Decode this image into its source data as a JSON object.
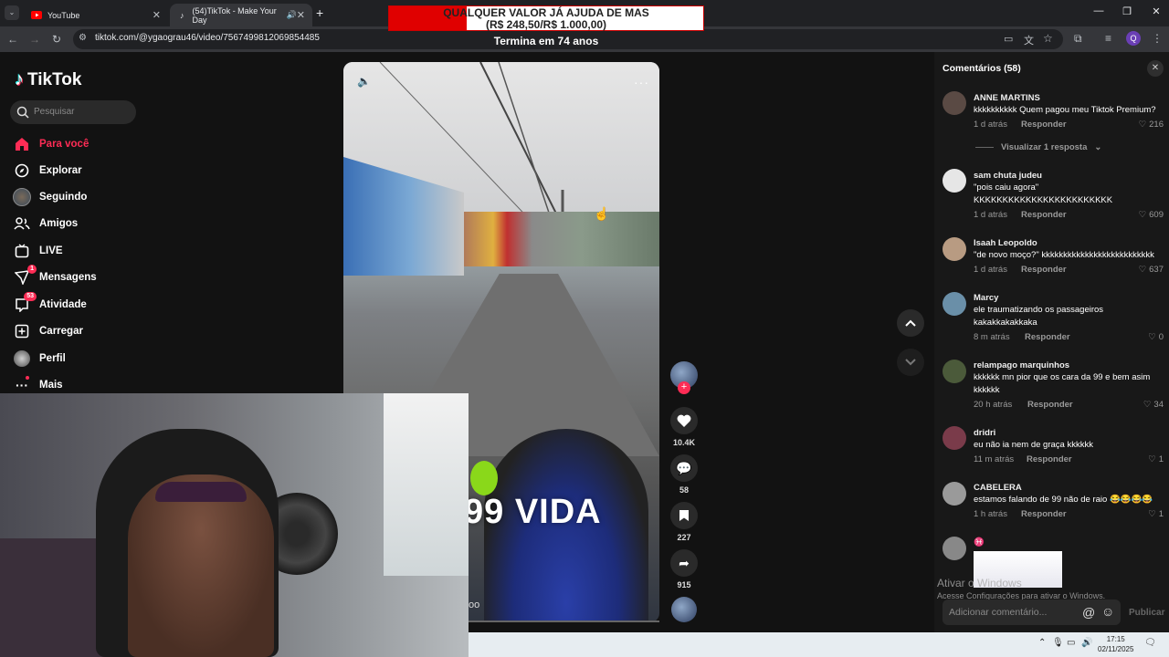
{
  "browser": {
    "tabs": [
      {
        "label": "YouTube",
        "active": false
      },
      {
        "label": "(54)TikTok - Make Your Day",
        "active": true
      }
    ],
    "url": "tiktok.com/@ygaograu46/video/7567499812069854485"
  },
  "donation": {
    "line1": "QUALQUER VALOR JÁ AJUDA DE MAS",
    "line2": "(R$ 248,50/R$ 1.000,00)",
    "line3": "Termina em 74 anos"
  },
  "sidebar": {
    "logo": "TikTok",
    "search_placeholder": "Pesquisar",
    "items": [
      {
        "label": "Para você",
        "icon": "home-icon",
        "active": true
      },
      {
        "label": "Explorar",
        "icon": "compass-icon"
      },
      {
        "label": "Seguindo",
        "icon": "avatar-icon"
      },
      {
        "label": "Amigos",
        "icon": "friends-icon"
      },
      {
        "label": "LIVE",
        "icon": "live-icon"
      },
      {
        "label": "Mensagens",
        "icon": "messages-icon",
        "badge": "1"
      },
      {
        "label": "Atividade",
        "icon": "activity-icon",
        "badge": "53"
      },
      {
        "label": "Carregar",
        "icon": "upload-icon"
      },
      {
        "label": "Perfil",
        "icon": "profile-icon"
      },
      {
        "label": "Mais",
        "icon": "more-icon"
      }
    ]
  },
  "video": {
    "caption_overlay": "99 VIDA",
    "likes": "10.4K",
    "comments": "58",
    "saves": "227",
    "shares": "915",
    "bottom_fragment": "oo"
  },
  "comments": {
    "title": "Comentários (58)",
    "view_replies": "Visualizar 1 resposta",
    "reply_label": "Responder",
    "items": [
      {
        "user": "ANNE MARTINS",
        "text": "kkkkkkkkkk Quem pagou meu Tiktok Premium?",
        "time": "1 d atrás",
        "likes": "216",
        "avatar": "#5a4a44"
      },
      {
        "user": "sam chuta judeu",
        "text": "\"pois caiu agora\" KKKKKKKKKKKKKKKKKKKKKKKK",
        "time": "1 d atrás",
        "likes": "609",
        "avatar": "#e6e6e6"
      },
      {
        "user": "Isaah Leopoldo",
        "text": "\"de novo moço?\" kkkkkkkkkkkkkkkkkkkkkkkkkk",
        "time": "1 d atrás",
        "likes": "637",
        "avatar": "#b89b82"
      },
      {
        "user": "Marcy",
        "text": "ele traumatizando os passageiros kakakkakakkaka",
        "time": "8 m atrás",
        "likes": "0",
        "avatar": "#6a8fa8"
      },
      {
        "user": "relampago marquinhos",
        "text": "kkkkkk mn pior que os cara da 99 e bem asim kkkkkk",
        "time": "20 h atrás",
        "likes": "34",
        "avatar": "#4b5a3a"
      },
      {
        "user": "dridri",
        "text": "eu não ia nem de graça kkkkkk",
        "time": "11 m atrás",
        "likes": "1",
        "avatar": "#7a3b4a"
      },
      {
        "user": "CABELERA",
        "text": "estamos falando de 99 não de raio 😂😂😂😂",
        "time": "1 h atrás",
        "likes": "1",
        "avatar": "#9a9a9a"
      },
      {
        "user": "♓",
        "text": "",
        "time": "",
        "likes": "",
        "avatar": "#888"
      }
    ],
    "input_placeholder": "Adicionar comentário...",
    "publish": "Publicar"
  },
  "watermark": {
    "line1": "Ativar o Windows",
    "line2": "Acesse Configurações para ativar o Windows."
  },
  "taskbar": {
    "time": "17:15",
    "date": "02/11/2025"
  }
}
